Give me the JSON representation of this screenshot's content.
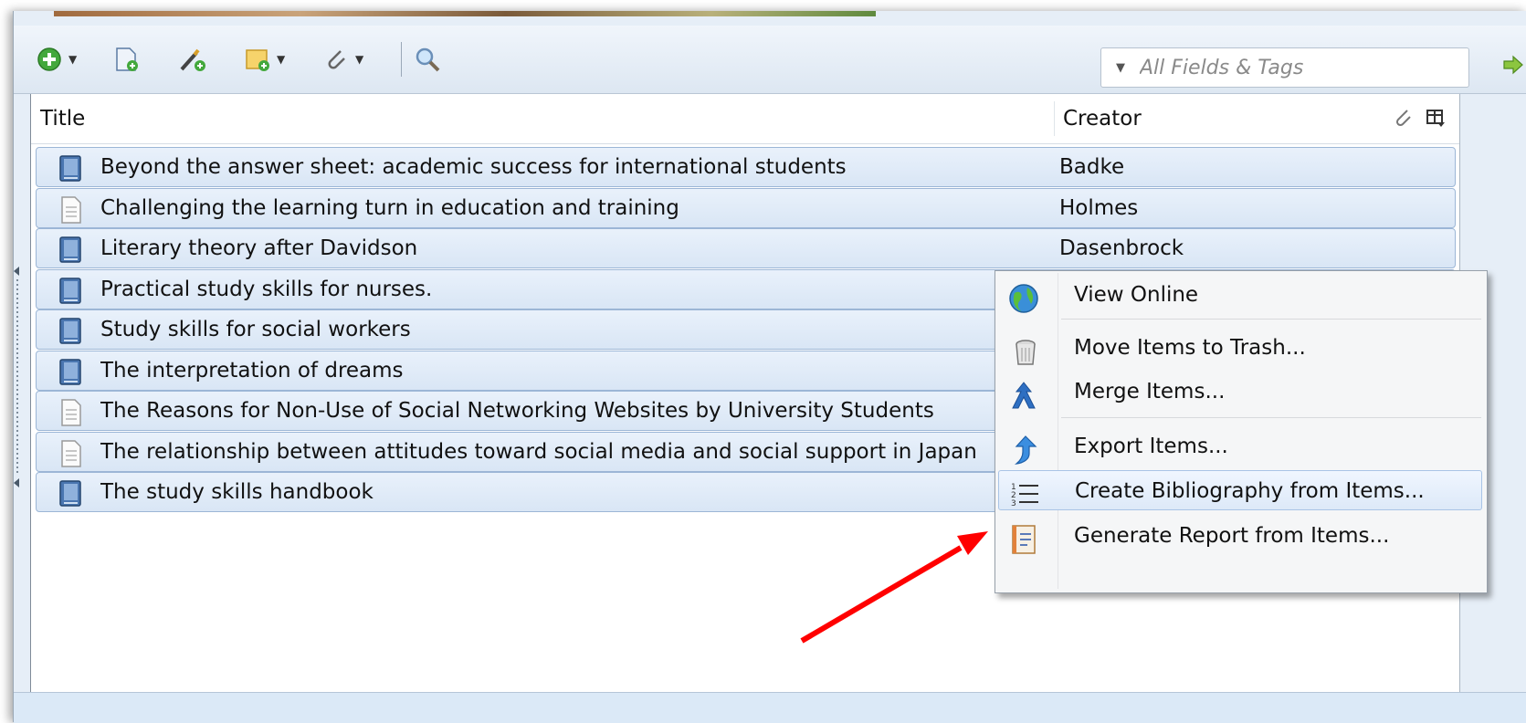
{
  "search": {
    "placeholder": "All Fields & Tags"
  },
  "columns": {
    "title": "Title",
    "creator": "Creator"
  },
  "items": [
    {
      "title": "Beyond the answer sheet: academic success for international students",
      "creator": "Badke",
      "type": "book"
    },
    {
      "title": "Challenging the learning turn in education and training",
      "creator": "Holmes",
      "type": "document"
    },
    {
      "title": "Literary theory after Davidson",
      "creator": "Dasenbrock",
      "type": "book"
    },
    {
      "title": "Practical study skills for nurses.",
      "creator": "",
      "type": "book"
    },
    {
      "title": "Study skills for social workers",
      "creator": "",
      "type": "book"
    },
    {
      "title": "The interpretation of dreams",
      "creator": "",
      "type": "book"
    },
    {
      "title": "The Reasons for Non-Use of Social Networking Websites by University Students",
      "creator": "",
      "type": "document"
    },
    {
      "title": "The relationship between attitudes toward social media and social support in Japan",
      "creator": "",
      "type": "document"
    },
    {
      "title": "The study skills handbook",
      "creator": "",
      "type": "book"
    }
  ],
  "context_menu": {
    "items": [
      {
        "label": "View Online",
        "icon": "globe-icon"
      },
      {
        "label": "Move Items to Trash...",
        "icon": "trash-icon"
      },
      {
        "label": "Merge Items...",
        "icon": "merge-icon"
      },
      {
        "label": "Export Items...",
        "icon": "export-icon"
      },
      {
        "label": "Create Bibliography from Items...",
        "icon": "bibliography-icon",
        "highlighted": true
      },
      {
        "label": "Generate Report from Items...",
        "icon": "report-icon"
      }
    ]
  },
  "colors": {
    "accent": "#2e7bd6",
    "row_selected": "#dbe8f6",
    "annotation_arrow": "#ff0000"
  }
}
